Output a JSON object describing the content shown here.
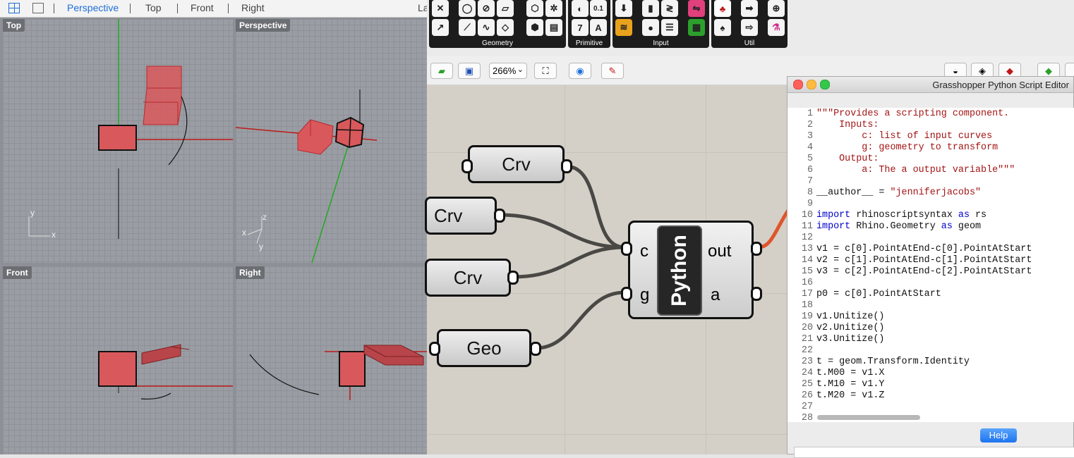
{
  "rhino": {
    "tabs": [
      "Perspective",
      "Top",
      "Front",
      "Right"
    ],
    "cut_tab": "La",
    "viewports": {
      "top": "Top",
      "perspective": "Perspective",
      "front": "Front",
      "right": "Right"
    },
    "axis_labels": {
      "x": "x",
      "y": "y",
      "z": "z"
    }
  },
  "toolbar": {
    "groups": [
      {
        "name": "Geometry"
      },
      {
        "name": "Primitive"
      },
      {
        "name": "Input"
      },
      {
        "name": "Util"
      }
    ],
    "zoom": "266%",
    "primitive_glyphs": [
      "0.1",
      "7",
      "A"
    ]
  },
  "canvas": {
    "params": [
      "Crv",
      "Crv",
      "Crv",
      "Geo"
    ],
    "python_component": {
      "title": "Python",
      "inputs": [
        "c",
        "g"
      ],
      "outputs": [
        "out",
        "a"
      ]
    }
  },
  "editor": {
    "title": "Grasshopper Python Script Editor",
    "help_label": "Help",
    "lines": [
      "\"\"\"Provides a scripting component.",
      "    Inputs:",
      "        c: list of input curves",
      "        g: geometry to transform",
      "    Output:",
      "        a: The a output variable\"\"\"",
      "",
      "__author__ = \"jenniferjacobs\"",
      "",
      "import rhinoscriptsyntax as rs",
      "import Rhino.Geometry as geom",
      "",
      "v1 = c[0].PointAtEnd-c[0].PointAtStart",
      "v2 = c[1].PointAtEnd-c[1].PointAtStart",
      "v3 = c[2].PointAtEnd-c[2].PointAtStart",
      "",
      "p0 = c[0].PointAtStart",
      "",
      "v1.Unitize()",
      "v2.Unitize()",
      "v3.Unitize()",
      "",
      "t = geom.Transform.Identity",
      "t.M00 = v1.X",
      "t.M10 = v1.Y",
      "t.M20 = v1.Z",
      "",
      ""
    ]
  },
  "colors": {
    "object_red": "#d9585c",
    "wire": "#4a4844",
    "wire_active": "#e0552b",
    "string": "#a31515",
    "keyword": "#0000cc",
    "help_button": "#3d8ff5"
  }
}
